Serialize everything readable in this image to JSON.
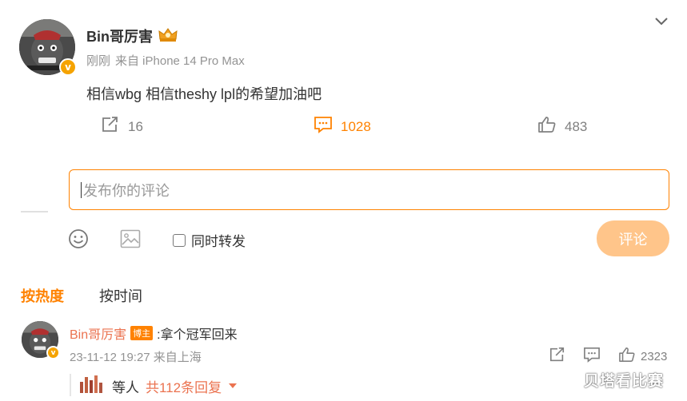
{
  "post": {
    "author": "Bin哥厉害",
    "time": "刚刚",
    "source": "来自 iPhone 14 Pro Max",
    "text": "相信wbg 相信theshy lpl的希望加油吧",
    "repost_count": "16",
    "comment_count": "1028",
    "like_count": "483"
  },
  "composer": {
    "placeholder": "发布你的评论",
    "repost_label": "同时转发",
    "submit_label": "评论"
  },
  "sort_tabs": {
    "hot": "按热度",
    "time": "按时间"
  },
  "comment": {
    "author": "Bin哥厉害",
    "badge": "博主",
    "text": ":拿个冠军回来",
    "meta": "23-11-12 19:27 来自上海",
    "like_count": "2323",
    "reply_who": "等人",
    "reply_more": "共112条回复"
  },
  "watermark": "贝塔看比赛",
  "colors": {
    "accent": "#ff8200",
    "name_link": "#eb7350",
    "submit_disabled": "#ffc58a"
  }
}
